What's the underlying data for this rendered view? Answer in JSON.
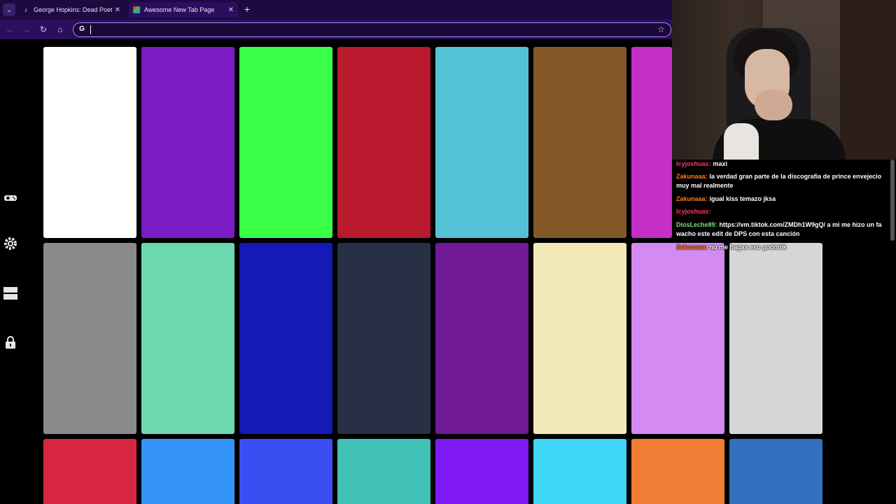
{
  "browser": {
    "tabs": [
      {
        "title": "George Hopkins: Dead Poets Sc",
        "favicon": "tiktok-icon",
        "active": false
      },
      {
        "title": "Awesome New Tab Page",
        "favicon": "colorful-grid-icon",
        "active": true
      }
    ],
    "address_value": "",
    "colors": {
      "tabbar": "#1d0a3f",
      "toolbar": "#2c0f5c",
      "omnibox_border": "#a98df0"
    }
  },
  "sidebar": {
    "icons": [
      "gamepad-icon",
      "gear-icon",
      "layout-icon",
      "lock-icon"
    ]
  },
  "tiles": [
    {
      "color": "#ffffff"
    },
    {
      "color": "#7b1bc6"
    },
    {
      "color": "#3bff46"
    },
    {
      "color": "#b91a2d"
    },
    {
      "color": "#54c2d6"
    },
    {
      "color": "#835a27"
    },
    {
      "color": "#c42fc7"
    },
    {
      "color": "#8a8a8a"
    },
    {
      "color": "#6bd8af"
    },
    {
      "color": "#1519b5"
    },
    {
      "color": "#283045"
    },
    {
      "color": "#701a98"
    },
    {
      "color": "#f3e9b9"
    },
    {
      "color": "#d38af2"
    },
    {
      "color": "#d6d6d6"
    },
    {
      "color": "#d92742"
    },
    {
      "color": "#3594f8"
    },
    {
      "color": "#3a4ff2"
    },
    {
      "color": "#42c2b7"
    },
    {
      "color": "#7e19f4"
    },
    {
      "color": "#3dd6f7"
    },
    {
      "color": "#f07d33"
    },
    {
      "color": "#3370be"
    }
  ],
  "chat": {
    "messages": [
      {
        "user": "lcyjoshuas:",
        "color": "#ff3a64",
        "text": "maxi"
      },
      {
        "user": "Zakunaaa:",
        "color": "#ff7a1a",
        "text": "la verdad gran parte de la discografia de prince envejecio muy mal realmente"
      },
      {
        "user": "Zakunaaa:",
        "color": "#ff7a1a",
        "text": "igual kiss temazo jksa"
      },
      {
        "user": "lcyjoshuas:",
        "color": "#ff3a64",
        "text": ""
      },
      {
        "user": "DiosLeche89:",
        "color": "#7ee07a",
        "text": "https://vm.tiktok.com/ZMDh1W9gQ/ a mi me hizo un fa wacho este edit de DPS con esta canción"
      },
      {
        "user": "Zakunaaa:",
        "color": "#ff7a1a",
        "text": "no me hagas eso godmilk"
      }
    ]
  }
}
